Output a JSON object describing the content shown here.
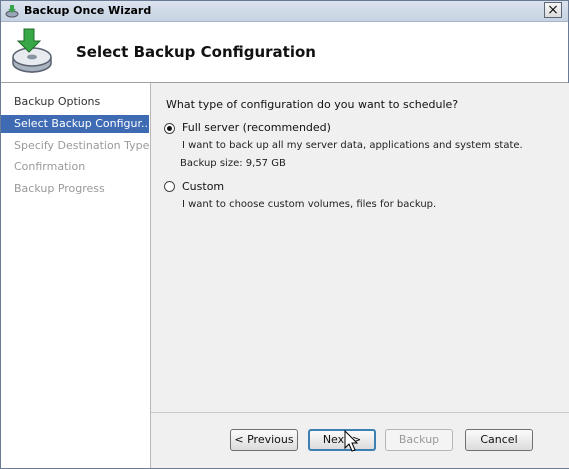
{
  "window": {
    "title": "Backup Once Wizard",
    "close_label": "×"
  },
  "header": {
    "title": "Select Backup Configuration",
    "icon": "backup-disk-icon"
  },
  "nav": {
    "items": [
      {
        "label": "Backup Options",
        "state": "done"
      },
      {
        "label": "Select Backup Configur...",
        "state": "selected"
      },
      {
        "label": "Specify Destination Type",
        "state": "disabled"
      },
      {
        "label": "Confirmation",
        "state": "disabled"
      },
      {
        "label": "Backup Progress",
        "state": "disabled"
      }
    ]
  },
  "content": {
    "question": "What type of configuration do you want to schedule?",
    "options": [
      {
        "label": "Full server (recommended)",
        "checked": true,
        "description": "I want to back up all my server data, applications and system state.",
        "extra": "Backup size: 9,57 GB"
      },
      {
        "label": "Custom",
        "checked": false,
        "description": "I want to choose custom volumes, files for backup."
      }
    ]
  },
  "buttons": {
    "previous": "< Previous",
    "next": "Next >",
    "backup": "Backup",
    "cancel": "Cancel"
  },
  "colors": {
    "selection": "#3e6bb3",
    "content_bg": "#f0f0f0",
    "title_bar": "#c7d3e2"
  }
}
